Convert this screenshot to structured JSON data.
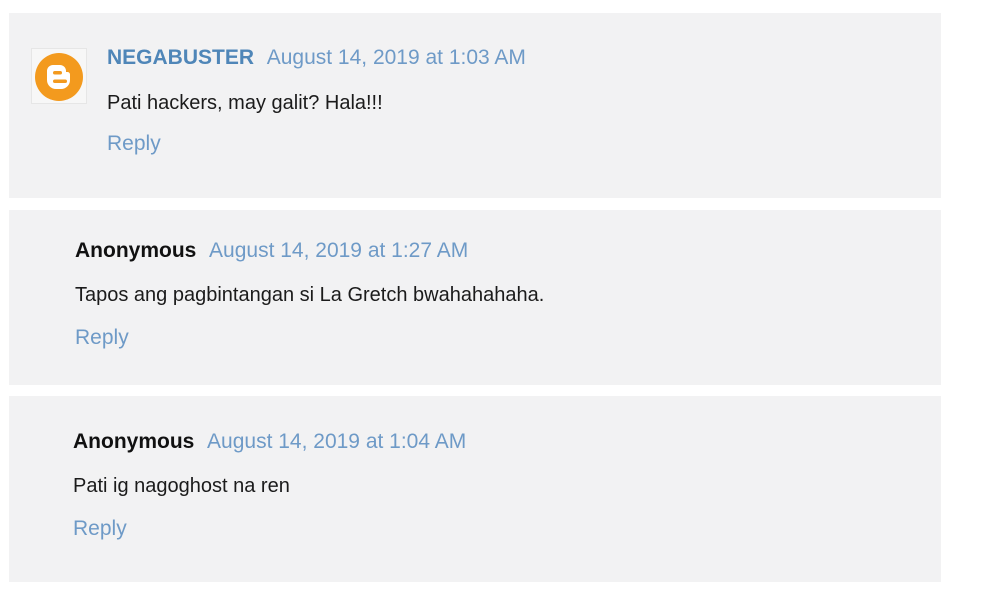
{
  "comments": [
    {
      "author": "NEGABUSTER",
      "timestamp": "August 14, 2019 at 1:03 AM",
      "text": "Pati hackers, may galit? Hala!!!",
      "reply_label": "Reply",
      "avatar_icon": "blogger-icon",
      "avatar_color": "#f39a1e"
    },
    {
      "author": "Anonymous",
      "timestamp": "August 14, 2019 at 1:27 AM",
      "text": "Tapos ang pagbintangan si La Gretch bwahahahaha.",
      "reply_label": "Reply"
    },
    {
      "author": "Anonymous",
      "timestamp": "August 14, 2019 at 1:04 AM",
      "text": "Pati ig nagoghost na ren",
      "reply_label": "Reply"
    }
  ],
  "colors": {
    "card_background": "#f2f2f3",
    "link": "#6e9ac7",
    "author_link": "#4f86b8",
    "text": "#1b1b1b"
  }
}
